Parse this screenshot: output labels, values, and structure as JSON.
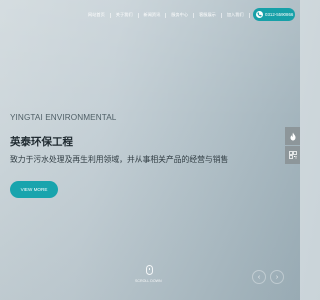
{
  "nav": {
    "items": [
      {
        "id": "home",
        "label": "网站首页"
      },
      {
        "id": "about",
        "label": "关于我们"
      },
      {
        "id": "news",
        "label": "新闻资讯"
      },
      {
        "id": "services",
        "label": "服务中心"
      },
      {
        "id": "cases",
        "label": "客服展示"
      },
      {
        "id": "join",
        "label": "加入我们"
      },
      {
        "id": "contact",
        "label": "联系我们"
      }
    ],
    "phone": "0312-5590866"
  },
  "hero": {
    "en_title": "YINGTAI ENVIRONMENTAL",
    "cn_title": "英泰环保工程",
    "subtitle": "致力于污水处理及再生利用领域，并从事相关产品的经营与销售",
    "button_label": "VIEW MORE"
  },
  "scroll": {
    "label": "SCROLL DOWN"
  },
  "colors": {
    "accent": "#17a0a8",
    "side_tool_bg": "#8d969a"
  },
  "icons": [
    "phone-icon",
    "mouse-icon",
    "chevron-left-icon",
    "chevron-right-icon",
    "flame-icon",
    "qr-code-icon"
  ]
}
